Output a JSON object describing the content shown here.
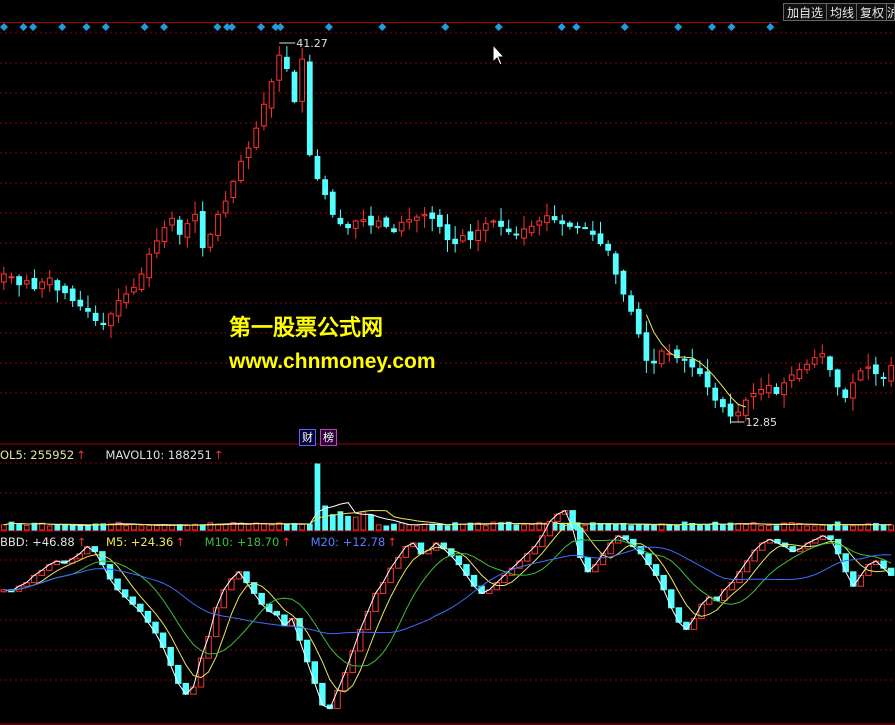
{
  "toolbar": {
    "buttons": [
      {
        "label": "加自选",
        "name": "add-watchlist-button"
      },
      {
        "label": "均线",
        "name": "moving-average-button"
      },
      {
        "label": "复权",
        "name": "adjust-price-button"
      },
      {
        "label": "沪",
        "name": "market-button"
      }
    ]
  },
  "price_chart": {
    "high_label": "41.27",
    "low_label": "12.85"
  },
  "badges": [
    {
      "label": "财",
      "name": "finance-badge",
      "color": "#2a6cff"
    },
    {
      "label": "榜",
      "name": "ranking-badge",
      "color": "#c040c0"
    }
  ],
  "volume_legend": {
    "mavol5": "OL5: 255952",
    "mavol10": "MAVOL10: 188251"
  },
  "indicator_legend": {
    "main": "BBD: +46.88",
    "m5": "M5: +24.36",
    "m10": "M10: +18.70",
    "m20": "M20: +12.78"
  },
  "watermark": {
    "line1": "第一股票公式网",
    "line2": "www.chnmoney.com"
  },
  "colors": {
    "up": "#ff3232",
    "down": "#54ffff",
    "grid": "#8b0000",
    "signal": "#1f9be0",
    "ma5": "#ffffff",
    "ma10": "#e8e85a",
    "ma20": "#3b6dff",
    "m10": "#3bbf3b",
    "watermark": "#ffff00"
  },
  "chart_data": {
    "type": "candlestick",
    "y_max": 41.27,
    "y_min": 12.85,
    "close_path": [
      24,
      23.8,
      23.2,
      23.5,
      22.9,
      23.4,
      23.7,
      22.8,
      22.6,
      22.0,
      21.6,
      21.2,
      20.5,
      20.2,
      21.0,
      22.0,
      22.5,
      23.0,
      24.0,
      25.5,
      26.5,
      27.5,
      28.2,
      27.0,
      27.8,
      28.5,
      26.0,
      27.0,
      28.5,
      29.5,
      31.0,
      32.5,
      33.5,
      35.0,
      36.8,
      38.5,
      40.5,
      39.5,
      37.0,
      40.2,
      33.0,
      31.2,
      30.0,
      28.5,
      27.8,
      27.5,
      28.0,
      28.1,
      27.7,
      28.0,
      27.6,
      27.2,
      27.9,
      28.1,
      28.3,
      28.5,
      28.2,
      27.6,
      26.6,
      26.3,
      26.9,
      26.6,
      27.3,
      27.8,
      28.0,
      27.6,
      27.2,
      27.0,
      27.4,
      27.6,
      28.0,
      28.4,
      28.1,
      27.8,
      27.6,
      27.5,
      27.5,
      27.0,
      26.3,
      25.8,
      24.0,
      22.5,
      21.2,
      19.5,
      17.5,
      17.3,
      18.2,
      18.0,
      17.7,
      17.5,
      17.0,
      16.5,
      15.5,
      14.5,
      14.0,
      13.3,
      13.6,
      14.5,
      15.0,
      15.3,
      15.6,
      15.0,
      15.8,
      16.4,
      16.8,
      17.2,
      17.7,
      18.0,
      16.8,
      15.5,
      14.7,
      15.8,
      16.7,
      17.0,
      16.5,
      16.2,
      17.1
    ],
    "volume_spike_index": 41,
    "bbd_path": [
      0.35,
      0.33,
      0.4,
      0.45,
      0.55,
      0.62,
      0.7,
      0.75,
      0.72,
      0.78,
      0.85,
      0.95,
      0.88,
      0.7,
      0.5,
      0.35,
      0.25,
      0.15,
      0.05,
      -0.1,
      -0.25,
      -0.45,
      -0.7,
      -0.95,
      -1.1,
      -1.0,
      -0.6,
      -0.3,
      0.1,
      0.35,
      0.5,
      0.6,
      0.45,
      0.3,
      0.15,
      0.05,
      0.0,
      -0.15,
      -0.05,
      -0.35,
      -0.65,
      -0.95,
      -1.25,
      -1.3,
      -1.05,
      -0.8,
      -0.5,
      -0.2,
      0.05,
      0.3,
      0.45,
      0.65,
      0.8,
      0.95,
      1.0,
      0.85,
      0.9,
      1.0,
      0.92,
      0.82,
      0.7,
      0.55,
      0.4,
      0.3,
      0.35,
      0.45,
      0.55,
      0.65,
      0.75,
      0.85,
      0.95,
      1.1,
      1.3,
      1.4,
      1.45,
      1.2,
      0.8,
      0.6,
      0.7,
      0.85,
      1.0,
      1.1,
      1.05,
      0.95,
      0.85,
      0.7,
      0.55,
      0.35,
      0.1,
      -0.1,
      -0.2,
      -0.05,
      0.15,
      0.25,
      0.2,
      0.35,
      0.45,
      0.6,
      0.75,
      0.9,
      1.0,
      1.05,
      1.0,
      0.95,
      0.88,
      0.92,
      1.0,
      1.05,
      1.1,
      1.05,
      0.85,
      0.6,
      0.4,
      0.55,
      0.7,
      0.75,
      0.65,
      0.55
    ],
    "signal_diamond_indices": [
      0,
      4,
      6,
      12,
      17,
      21,
      29,
      33,
      44,
      46,
      47,
      53,
      56,
      57,
      67,
      78,
      91,
      102,
      115,
      118,
      128,
      139,
      146,
      150,
      158,
      162,
      171
    ]
  }
}
